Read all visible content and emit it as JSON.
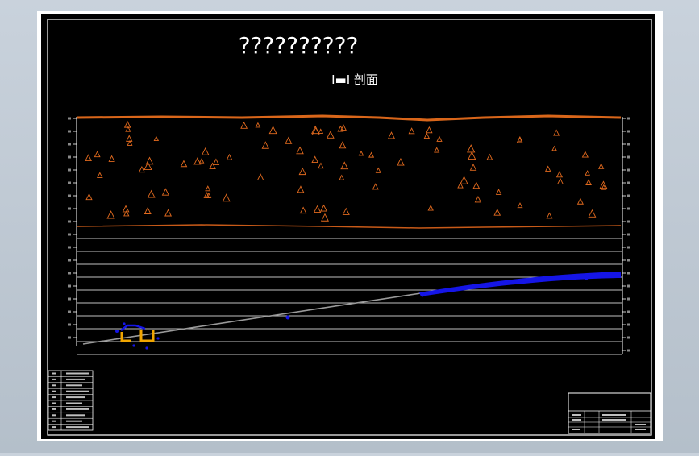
{
  "drawing": {
    "title_placeholder": "??????????",
    "section_title": "I▬I 剖面"
  },
  "colors": {
    "paper": "#000000",
    "frame": "#ffffff",
    "soil_top_line": "#d9661a",
    "soil_marks": "#e26a1e",
    "rock_line": "#ffffff",
    "rock_boundary": "#c85a18",
    "strata_lines": "#ffffff",
    "tunnel_line": "#9a9a9a",
    "blue_body": "#1515e6",
    "structure": "#f0a500"
  },
  "icons": {
    "soil_symbol": "triangle-mark",
    "blue_dot": "marker-dot"
  }
}
